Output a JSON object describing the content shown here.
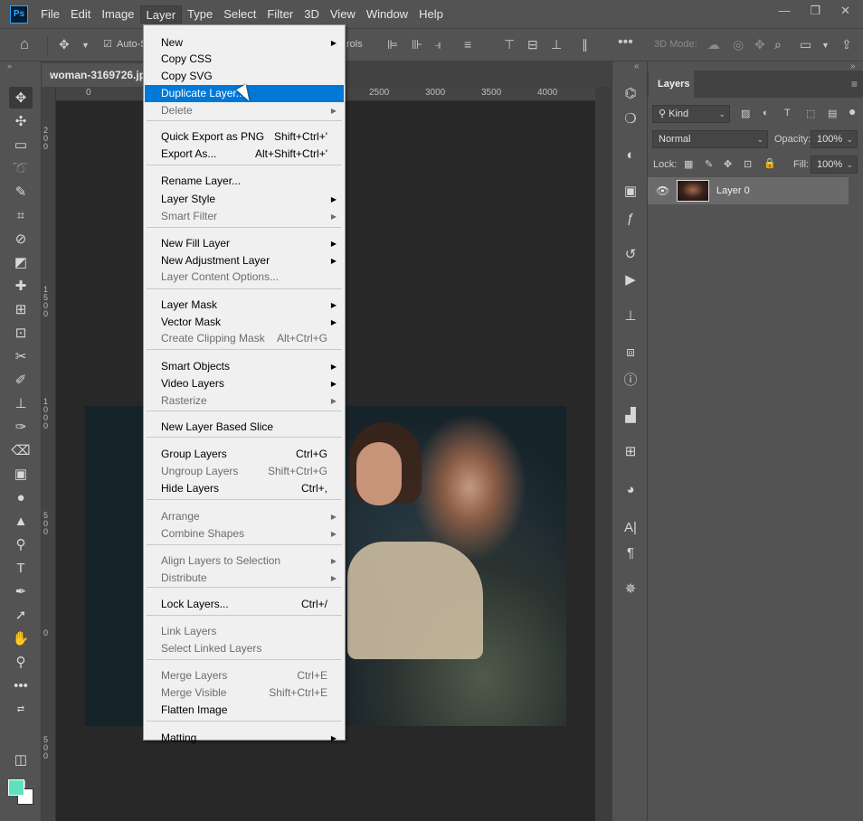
{
  "app": {
    "logo": "Ps"
  },
  "menubar": [
    "File",
    "Edit",
    "Image",
    "Layer",
    "Type",
    "Select",
    "Filter",
    "3D",
    "View",
    "Window",
    "Help"
  ],
  "window_controls": [
    "—",
    "❐",
    "✕"
  ],
  "options": {
    "auto_select": "Auto-S",
    "controls_fragment": "rols",
    "mode_3d": "3D Mode:"
  },
  "document": {
    "tab_title": "woman-3169726.jpg"
  },
  "ruler": {
    "h": [
      "0",
      "2500",
      "3000",
      "3500",
      "4000"
    ],
    "v": [
      "2\n0\n0",
      "1\n5\n0\n0",
      "1\n0\n0\n0",
      "5\n0\n0",
      "0",
      "5\n0\n0"
    ]
  },
  "layer_menu": {
    "items": [
      {
        "label": "New",
        "submenu": true
      },
      {
        "label": "Copy CSS"
      },
      {
        "label": "Copy SVG"
      },
      {
        "label": "Duplicate Layer...",
        "highlighted": true
      },
      {
        "label": "Delete",
        "disabled": true,
        "submenu": true
      },
      {
        "sep": true
      },
      {
        "label": "Quick Export as PNG",
        "shortcut": "Shift+Ctrl+'"
      },
      {
        "label": "Export As...",
        "shortcut": "Alt+Shift+Ctrl+'"
      },
      {
        "sep": true
      },
      {
        "label": "Rename Layer..."
      },
      {
        "label": "Layer Style",
        "submenu": true
      },
      {
        "label": "Smart Filter",
        "disabled": true,
        "submenu": true
      },
      {
        "sep": true
      },
      {
        "label": "New Fill Layer",
        "submenu": true
      },
      {
        "label": "New Adjustment Layer",
        "submenu": true
      },
      {
        "label": "Layer Content Options...",
        "disabled": true
      },
      {
        "sep": true
      },
      {
        "label": "Layer Mask",
        "submenu": true
      },
      {
        "label": "Vector Mask",
        "submenu": true
      },
      {
        "label": "Create Clipping Mask",
        "disabled": true,
        "shortcut": "Alt+Ctrl+G"
      },
      {
        "sep": true
      },
      {
        "label": "Smart Objects",
        "submenu": true
      },
      {
        "label": "Video Layers",
        "submenu": true
      },
      {
        "label": "Rasterize",
        "disabled": true,
        "submenu": true
      },
      {
        "sep": true
      },
      {
        "label": "New Layer Based Slice"
      },
      {
        "sep": true
      },
      {
        "label": "Group Layers",
        "shortcut": "Ctrl+G"
      },
      {
        "label": "Ungroup Layers",
        "disabled": true,
        "shortcut": "Shift+Ctrl+G"
      },
      {
        "label": "Hide Layers",
        "shortcut": "Ctrl+,"
      },
      {
        "sep": true
      },
      {
        "label": "Arrange",
        "disabled": true,
        "submenu": true
      },
      {
        "label": "Combine Shapes",
        "disabled": true,
        "submenu": true
      },
      {
        "sep": true
      },
      {
        "label": "Align Layers to Selection",
        "disabled": true,
        "submenu": true
      },
      {
        "label": "Distribute",
        "disabled": true,
        "submenu": true
      },
      {
        "sep": true
      },
      {
        "label": "Lock Layers...",
        "shortcut": "Ctrl+/"
      },
      {
        "sep": true
      },
      {
        "label": "Link Layers",
        "disabled": true
      },
      {
        "label": "Select Linked Layers",
        "disabled": true
      },
      {
        "sep": true
      },
      {
        "label": "Merge Layers",
        "disabled": true,
        "shortcut": "Ctrl+E"
      },
      {
        "label": "Merge Visible",
        "disabled": true,
        "shortcut": "Shift+Ctrl+E"
      },
      {
        "label": "Flatten Image"
      },
      {
        "sep": true
      },
      {
        "label": "Matting",
        "submenu": true
      }
    ]
  },
  "layers_panel": {
    "tab": "Layers",
    "filter_kind": "Kind",
    "blend_mode": "Normal",
    "opacity_label": "Opacity:",
    "opacity_value": "100%",
    "lock_label": "Lock:",
    "fill_label": "Fill:",
    "fill_value": "100%",
    "layers": [
      {
        "name": "Layer 0"
      }
    ]
  },
  "colors": {
    "foreground": "#5fe0c0",
    "background": "#ffffff",
    "highlight": "#0078d7"
  }
}
